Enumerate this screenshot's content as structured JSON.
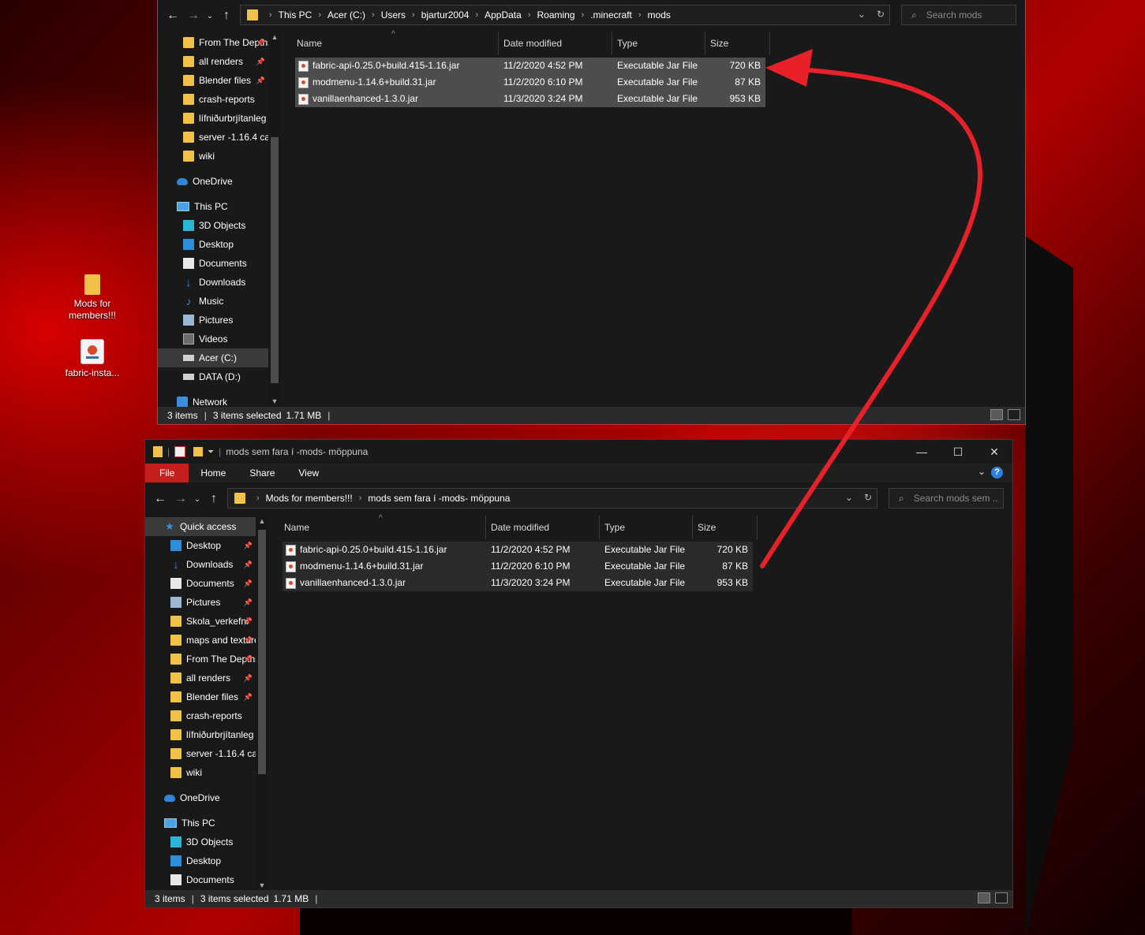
{
  "desktop": {
    "icons": [
      {
        "label": "Mods for members!!!",
        "icon": "folder-icon"
      },
      {
        "label": "fabric-insta...",
        "icon": "java-installer-icon"
      }
    ]
  },
  "window1": {
    "breadcrumb": [
      "This PC",
      "Acer (C:)",
      "Users",
      "bjartur2004",
      "AppData",
      "Roaming",
      ".minecraft",
      "mods"
    ],
    "search_placeholder": "Search mods",
    "nav_items": [
      {
        "label": "From The Depths",
        "icon": "folder-icon",
        "pinned": true
      },
      {
        "label": "all renders",
        "icon": "folder-icon",
        "pinned": true
      },
      {
        "label": "Blender files",
        "icon": "folder-icon",
        "pinned": true
      },
      {
        "label": "crash-reports",
        "icon": "folder-icon",
        "pinned": false
      },
      {
        "label": "lífniðurbrjítanleg",
        "icon": "folder-icon",
        "pinned": false
      },
      {
        "label": "server -1.16.4 ca",
        "icon": "folder-icon",
        "pinned": false
      },
      {
        "label": "wiki",
        "icon": "folder-icon",
        "pinned": false
      },
      {
        "label": "OneDrive",
        "icon": "cloud-icon",
        "pinned": false
      },
      {
        "label": "This PC",
        "icon": "pc-icon",
        "pinned": false
      },
      {
        "label": "3D Objects",
        "icon": "cube-icon",
        "pinned": false
      },
      {
        "label": "Desktop",
        "icon": "desktop-icon",
        "pinned": false
      },
      {
        "label": "Documents",
        "icon": "documents-icon",
        "pinned": false
      },
      {
        "label": "Downloads",
        "icon": "download-icon",
        "pinned": false
      },
      {
        "label": "Music",
        "icon": "music-icon",
        "pinned": false
      },
      {
        "label": "Pictures",
        "icon": "pictures-icon",
        "pinned": false
      },
      {
        "label": "Videos",
        "icon": "videos-icon",
        "pinned": false
      },
      {
        "label": "Acer (C:)",
        "icon": "drive-icon",
        "pinned": false
      },
      {
        "label": "DATA (D:)",
        "icon": "drive-icon",
        "pinned": false
      },
      {
        "label": "Network",
        "icon": "network-icon",
        "pinned": false
      }
    ],
    "columns": {
      "name": "Name",
      "date": "Date modified",
      "type": "Type",
      "size": "Size"
    },
    "files": [
      {
        "name": "fabric-api-0.25.0+build.415-1.16.jar",
        "date": "11/2/2020 4:52 PM",
        "type": "Executable Jar File",
        "size": "720 KB"
      },
      {
        "name": "modmenu-1.14.6+build.31.jar",
        "date": "11/2/2020 6:10 PM",
        "type": "Executable Jar File",
        "size": "87 KB"
      },
      {
        "name": "vanillaenhanced-1.3.0.jar",
        "date": "11/3/2020 3:24 PM",
        "type": "Executable Jar File",
        "size": "953 KB"
      }
    ],
    "status": {
      "count": "3 items",
      "selected": "3 items selected",
      "size": "1.71 MB"
    }
  },
  "window2": {
    "title": "mods sem fara í -mods- möppuna",
    "ribbon_tabs": [
      "File",
      "Home",
      "Share",
      "View"
    ],
    "help": "?",
    "breadcrumb": [
      "Mods for members!!!",
      "mods sem fara í -mods- möppuna"
    ],
    "search_placeholder": "Search mods sem ...",
    "nav_items": [
      {
        "label": "Quick access",
        "icon": "star-icon",
        "pinned": false
      },
      {
        "label": "Desktop",
        "icon": "desktop-icon",
        "pinned": true
      },
      {
        "label": "Downloads",
        "icon": "download-icon",
        "pinned": true
      },
      {
        "label": "Documents",
        "icon": "documents-icon",
        "pinned": true
      },
      {
        "label": "Pictures",
        "icon": "pictures-icon",
        "pinned": true
      },
      {
        "label": "Skola_verkefni",
        "icon": "folder-icon",
        "pinned": true
      },
      {
        "label": "maps and textures",
        "icon": "folder-icon",
        "pinned": true
      },
      {
        "label": "From The Depths",
        "icon": "folder-icon",
        "pinned": true
      },
      {
        "label": "all renders",
        "icon": "folder-icon",
        "pinned": true
      },
      {
        "label": "Blender files",
        "icon": "folder-icon",
        "pinned": true
      },
      {
        "label": "crash-reports",
        "icon": "folder-icon",
        "pinned": false
      },
      {
        "label": "lífniðurbrjítanleg",
        "icon": "folder-icon",
        "pinned": false
      },
      {
        "label": "server -1.16.4 ca",
        "icon": "folder-icon",
        "pinned": false
      },
      {
        "label": "wiki",
        "icon": "folder-icon",
        "pinned": false
      },
      {
        "label": "OneDrive",
        "icon": "cloud-icon",
        "pinned": false
      },
      {
        "label": "This PC",
        "icon": "pc-icon",
        "pinned": false
      },
      {
        "label": "3D Objects",
        "icon": "cube-icon",
        "pinned": false
      },
      {
        "label": "Desktop",
        "icon": "desktop-icon",
        "pinned": false
      },
      {
        "label": "Documents",
        "icon": "documents-icon",
        "pinned": false
      }
    ],
    "columns": {
      "name": "Name",
      "date": "Date modified",
      "type": "Type",
      "size": "Size"
    },
    "files": [
      {
        "name": "fabric-api-0.25.0+build.415-1.16.jar",
        "date": "11/2/2020 4:52 PM",
        "type": "Executable Jar File",
        "size": "720 KB"
      },
      {
        "name": "modmenu-1.14.6+build.31.jar",
        "date": "11/2/2020 6:10 PM",
        "type": "Executable Jar File",
        "size": "87 KB"
      },
      {
        "name": "vanillaenhanced-1.3.0.jar",
        "date": "11/3/2020 3:24 PM",
        "type": "Executable Jar File",
        "size": "953 KB"
      }
    ],
    "status": {
      "count": "3 items",
      "selected": "3 items selected",
      "size": "1.71 MB"
    }
  },
  "colors": {
    "accent_file_tab": "#c41e1e",
    "annotation_arrow": "#e8202a",
    "selection": "#4d4d4d"
  }
}
